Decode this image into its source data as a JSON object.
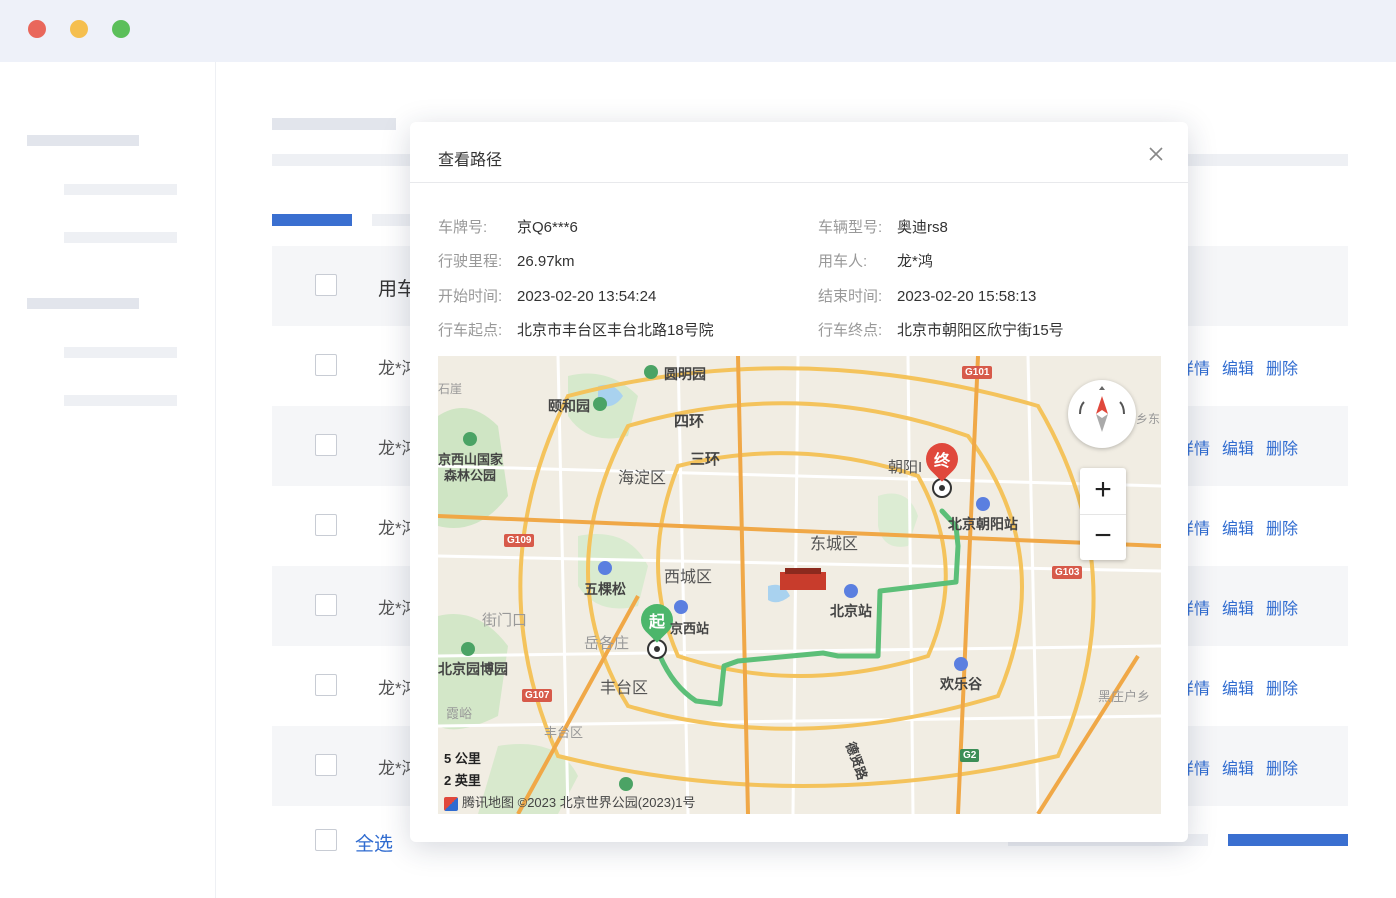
{
  "window": {
    "traffic_lights": [
      "#e9675b",
      "#f5bf4f",
      "#5bbf5a"
    ]
  },
  "table": {
    "header_label": "用车",
    "rows": [
      {
        "name": "龙*鸿"
      },
      {
        "name": "龙*鸿"
      },
      {
        "name": "龙*鸿"
      },
      {
        "name": "龙*鸿"
      },
      {
        "name": "龙*鸿"
      },
      {
        "name": "龙*鸿"
      }
    ],
    "actions": {
      "detail": "详情",
      "edit": "编辑",
      "delete": "删除"
    },
    "select_all": "全选"
  },
  "modal": {
    "title": "查看路径",
    "fields": {
      "plate_label": "车牌号:",
      "plate_value": "京Q6***6",
      "model_label": "车辆型号:",
      "model_value": "奥迪rs8",
      "mileage_label": "行驶里程:",
      "mileage_value": "26.97km",
      "user_label": "用车人:",
      "user_value": "龙*鸿",
      "start_time_label": "开始时间:",
      "start_time_value": "2023-02-20 13:54:24",
      "end_time_label": "结束时间:",
      "end_time_value": "2023-02-20 15:58:13",
      "start_point_label": "行车起点:",
      "start_point_value": "北京市丰台区丰台北路18号院",
      "end_point_label": "行车终点:",
      "end_point_value": "北京市朝阳区欣宁街15号"
    },
    "map": {
      "labels": {
        "yuanmingyuan": "圆明园",
        "yiheyuan": "颐和园",
        "sihuan": "四环",
        "sanhuan": "三环",
        "haidian": "海淀区",
        "xishan": "京西山国家",
        "forest": "森林公园",
        "chaoyang": "朝阳I",
        "chaoyang_station": "北京朝阳站",
        "dongcheng": "东城区",
        "xicheng": "西城区",
        "wukesong": "五棵松",
        "beijing_station": "北京站",
        "west_station": "京西站",
        "yuegezhuang": "岳各庄",
        "yamen": "街门口",
        "garden_expo": "北京园博园",
        "fengtai": "丰台区",
        "fengtai2": "丰台区",
        "happy_valley": "欢乐谷",
        "heizhuanghu": "黑庄户乡",
        "xiayu": "霞峪",
        "dexian": "德贤路",
        "shiya": "石崖",
        "xiang": "乡东"
      },
      "highways": [
        "G101",
        "G109",
        "G103",
        "G107",
        "G2"
      ],
      "start_marker": "起",
      "end_marker": "终",
      "scale_km": "5 公里",
      "scale_mi": "2 英里",
      "copyright": "腾讯地图  ©2023 北京世界公园(2023)1号",
      "zoom_in": "+",
      "zoom_out": "−",
      "route_color": "#5cbf78"
    }
  }
}
